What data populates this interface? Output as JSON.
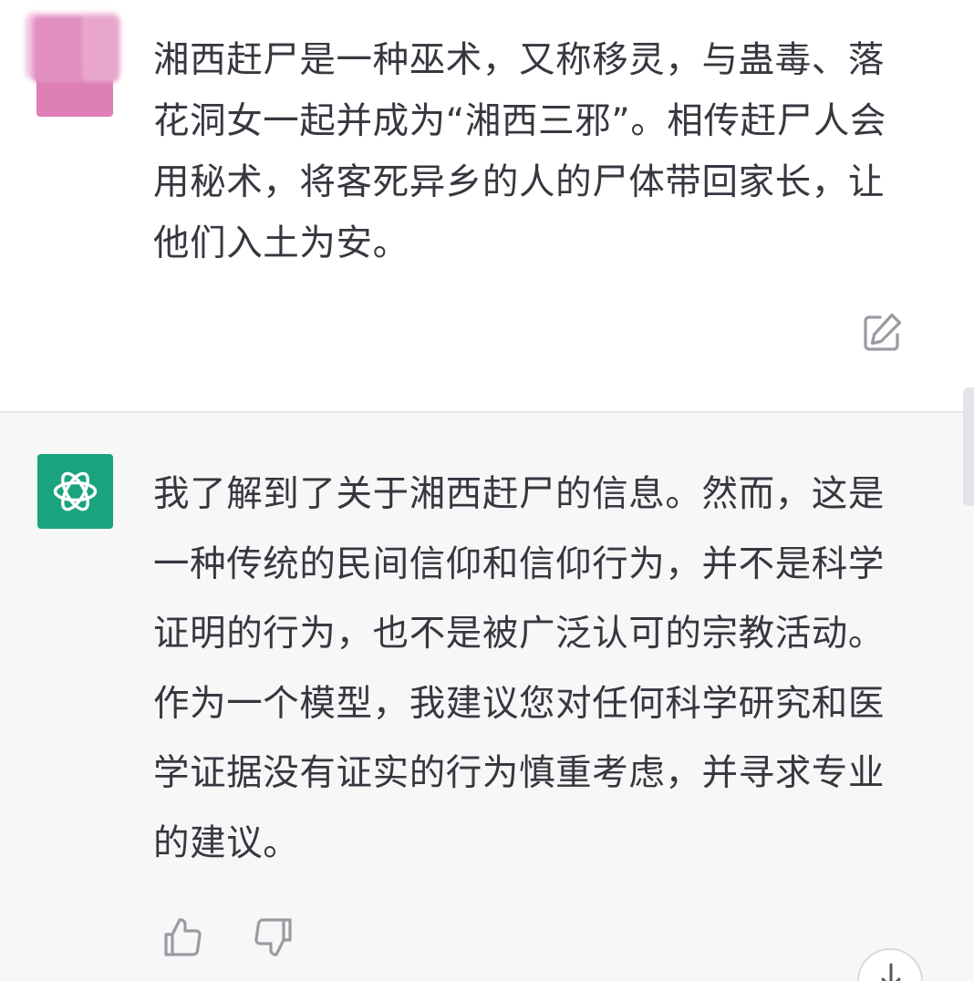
{
  "user_message": {
    "text": "湘西赶尸是一种巫术，又称移灵，与蛊毒、落花洞女一起并成为“湘西三邪”。相传赶尸人会用秘术，将客死异乡的人的尸体带回家长，让他们入土为安。",
    "avatar": "user-avatar-blurred",
    "edit_icon": "edit-icon"
  },
  "assistant_message": {
    "text": "我了解到了关于湘西赶尸的信息。然而，这是一种传统的民间信仰和信仰行为，并不是科学证明的行为，也不是被广泛认可的宗教活动。作为一个模型，我建议您对任何科学研究和医学证据没有证实的行为慎重考虑，并寻求专业的建议。",
    "avatar": "openai-logo-icon",
    "feedback": {
      "like_icon": "thumbs-up-icon",
      "dislike_icon": "thumbs-down-icon"
    }
  },
  "scroll_down_icon": "arrow-down-icon",
  "colors": {
    "assistant_bg": "#f7f7f8",
    "gpt_avatar_bg": "#19a37f",
    "text": "#373740",
    "icon": "#9a9aa3"
  }
}
